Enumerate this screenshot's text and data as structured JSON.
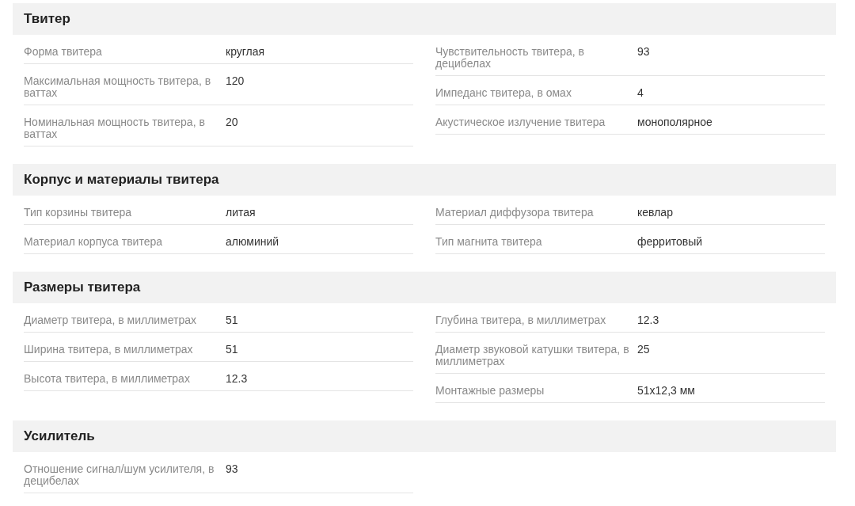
{
  "sections": [
    {
      "title": "Твитер",
      "columns": [
        [
          {
            "label": "Форма твитера",
            "value": "круглая"
          },
          {
            "label": "Максимальная мощность твитера, в ваттах",
            "value": "120"
          },
          {
            "label": "Номинальная мощность твитера, в ваттах",
            "value": "20"
          }
        ],
        [
          {
            "label": "Чувствительность твитера, в децибелах",
            "value": "93"
          },
          {
            "label": "Импеданс твитера, в омах",
            "value": "4"
          },
          {
            "label": "Акустическое излучение твитера",
            "value": "монополярное"
          }
        ]
      ]
    },
    {
      "title": "Корпус и материалы твитера",
      "columns": [
        [
          {
            "label": "Тип корзины твитера",
            "value": "литая"
          },
          {
            "label": "Материал корпуса твитера",
            "value": "алюминий"
          }
        ],
        [
          {
            "label": "Материал диффузора твитера",
            "value": "кевлар"
          },
          {
            "label": "Тип магнита твитера",
            "value": "ферритовый"
          }
        ]
      ]
    },
    {
      "title": "Размеры твитера",
      "columns": [
        [
          {
            "label": "Диаметр твитера, в миллиметрах",
            "value": "51"
          },
          {
            "label": "Ширина твитера, в миллиметрах",
            "value": "51"
          },
          {
            "label": "Высота твитера, в миллиметрах",
            "value": "12.3"
          }
        ],
        [
          {
            "label": "Глубина твитера, в миллиметрах",
            "value": "12.3"
          },
          {
            "label": "Диаметр звуковой катушки твитера, в миллиметрах",
            "value": "25"
          },
          {
            "label": "Монтажные размеры",
            "value": "51x12,3 мм"
          }
        ]
      ]
    },
    {
      "title": "Усилитель",
      "columns": [
        [
          {
            "label": "Отношение сигнал/шум усилителя, в децибелах",
            "value": "93"
          }
        ],
        []
      ]
    }
  ]
}
